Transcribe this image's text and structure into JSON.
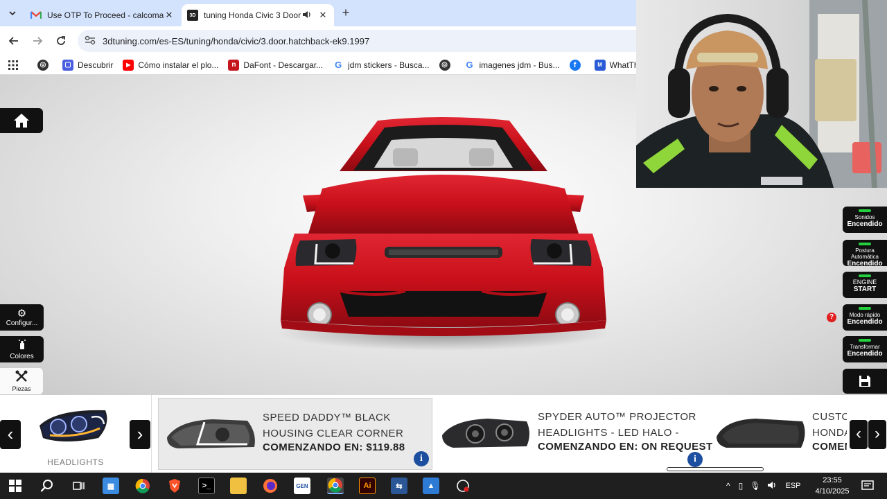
{
  "browser": {
    "tabs": [
      {
        "title": "Use OTP To Proceed - calcomar",
        "favicon": "gmail-icon",
        "active": false
      },
      {
        "title": "tuning Honda Civic 3 Door",
        "favicon": "3dtuning-icon",
        "active": true
      }
    ],
    "new_tab_label": "+",
    "url": "3dtuning.com/es-ES/tuning/honda/civic/3.door.hatchback-ek9.1997",
    "bookmarks": [
      {
        "label": "",
        "icon": "globe-icon"
      },
      {
        "label": "Descubrir",
        "icon": "discover-icon"
      },
      {
        "label": "Cómo instalar el plo...",
        "icon": "youtube-icon"
      },
      {
        "label": "DaFont - Descargar...",
        "icon": "dafont-icon"
      },
      {
        "label": "jdm stickers - Busca...",
        "icon": "google-icon"
      },
      {
        "label": "",
        "icon": "globe-icon"
      },
      {
        "label": "imagenes jdm - Bus...",
        "icon": "google-icon"
      },
      {
        "label": "",
        "icon": "facebook-icon"
      },
      {
        "label": "WhatTheFont! « M",
        "icon": "whatthefont-icon"
      }
    ]
  },
  "viewer": {
    "left_buttons": {
      "configure": "Configur...",
      "colors": "Colores",
      "parts": "Piezas"
    },
    "right_buttons": [
      {
        "line1": "Sonidos",
        "line2": "Encendido"
      },
      {
        "line1": "Postura Automática",
        "line2": "Encendido"
      },
      {
        "line1": "ENGINE",
        "line2": "START"
      },
      {
        "line1": "Modo rápido",
        "line2": "Encendido"
      },
      {
        "line1": "Transformar",
        "line2": "Encendido"
      }
    ],
    "help_badge": "?"
  },
  "parts_bar": {
    "category": "HEADLIGHTS",
    "products": [
      {
        "name_line1": "SPEED DADDY™ BLACK",
        "name_line2": "HOUSING CLEAR CORNER",
        "price": "COMENZANDO EN: $119.88",
        "selected": true
      },
      {
        "name_line1": "SPYDER AUTO™ PROJECTOR",
        "name_line2": "HEADLIGHTS - LED HALO -",
        "price": "COMENZANDO EN: ON REQUEST",
        "selected": false
      },
      {
        "name_line1": "CUSTO",
        "name_line2": "HONDA",
        "price": "COMEN",
        "selected": false
      }
    ],
    "info_label": "i"
  },
  "taskbar": {
    "language": "ESP",
    "time": "23:55",
    "date": "4/10/2025"
  },
  "colors": {
    "car_red": "#c8101a",
    "tab_bar": "#d3e3fd",
    "toggle_green": "#25d03f",
    "info_blue": "#1d4fa0"
  }
}
